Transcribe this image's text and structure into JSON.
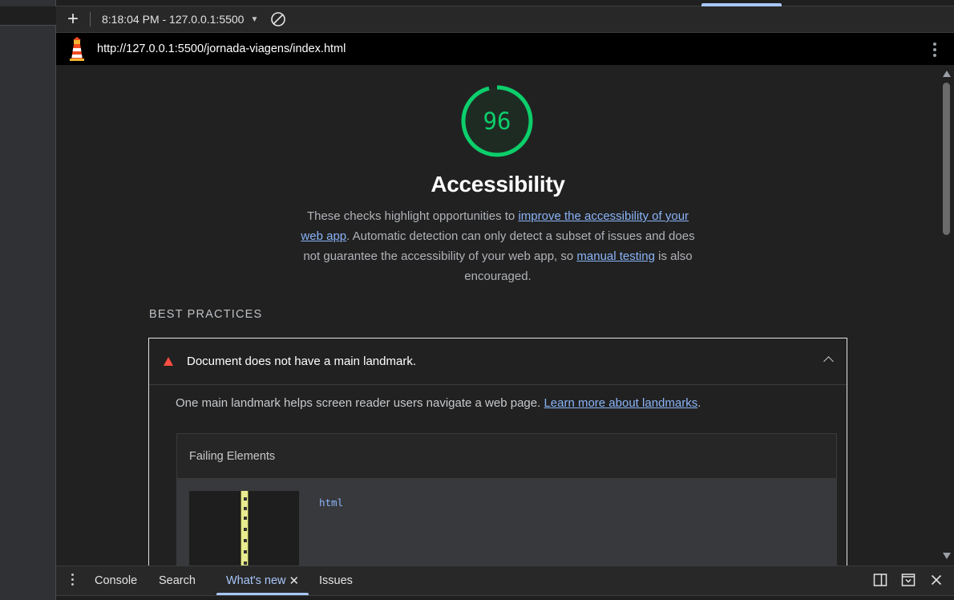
{
  "toolbar": {
    "new_report_label": "+",
    "report_select": "8:18:04 PM - 127.0.0.1:5500"
  },
  "urlbar": {
    "url": "http://127.0.0.1:5500/jornada-viagens/index.html"
  },
  "category": {
    "score": "96",
    "title": "Accessibility",
    "desc_before": "These checks highlight opportunities to ",
    "desc_link1": "improve the accessibility of your web app",
    "desc_middle": ". Automatic detection can only detect a subset of issues and does not guarantee the accessibility of your web app, so ",
    "desc_link2": "manual testing",
    "desc_after": " is also encouraged.",
    "score_color": "#0cce6b"
  },
  "group": {
    "title": "BEST PRACTICES"
  },
  "audit": {
    "title": "Document does not have a main landmark.",
    "desc_before": "One main landmark helps screen reader users navigate a web page. ",
    "desc_link": "Learn more about landmarks",
    "desc_after": ".",
    "failing_header": "Failing Elements",
    "node": "html",
    "status_color": "#ff4e42"
  },
  "drawer": {
    "tabs": [
      {
        "label": "Console"
      },
      {
        "label": "Search"
      },
      {
        "label": "What's new",
        "active": true
      },
      {
        "label": "Issues"
      }
    ],
    "close_glyph": "✕"
  }
}
